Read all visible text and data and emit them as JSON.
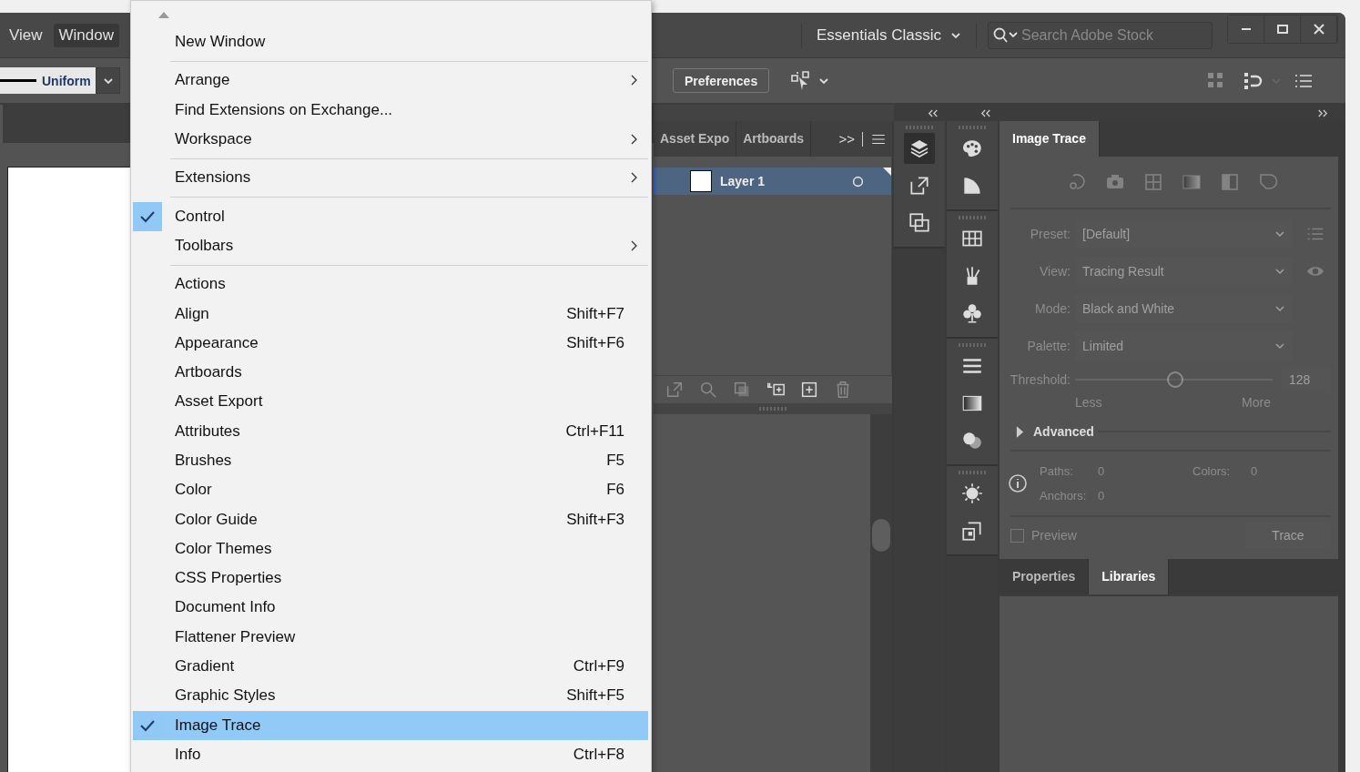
{
  "menubar": [
    {
      "label": "View",
      "selected": false
    },
    {
      "label": "Window",
      "selected": true
    }
  ],
  "workspace": {
    "label": "Essentials Classic"
  },
  "search": {
    "placeholder": "Search Adobe Stock"
  },
  "control_bar": {
    "stroke_profile": "Uniform",
    "preferences_button": "Preferences"
  },
  "layers_panel": {
    "tabs": [
      {
        "label": "Asset Expo",
        "selected": false
      },
      {
        "label": "Artboards",
        "selected": false
      }
    ],
    "overflow": ">>",
    "layers": [
      {
        "name": "Layer 1",
        "selected": true
      }
    ]
  },
  "image_trace": {
    "tabs": [
      {
        "label": "Image Trace",
        "selected": true
      }
    ],
    "disabled": true,
    "fields": [
      {
        "label": "Preset:",
        "value": "[Default]"
      },
      {
        "label": "View:",
        "value": "Tracing Result"
      },
      {
        "label": "Mode:",
        "value": "Black and White"
      },
      {
        "label": "Palette:",
        "value": "Limited"
      }
    ],
    "threshold": {
      "label": "Threshold:",
      "level": 0.5,
      "value": "128",
      "min_label": "Less",
      "max_label": "More"
    },
    "advanced": {
      "label": "Advanced",
      "expanded": false
    },
    "stats": [
      {
        "label": "Paths:",
        "value": "0"
      },
      {
        "label": "Colors:",
        "value": "0"
      },
      {
        "label": "Anchors:",
        "value": "0"
      }
    ],
    "preview": {
      "label": "Preview",
      "checked": false
    },
    "trace_button": "Trace"
  },
  "bottom_tabs": [
    {
      "label": "Properties",
      "selected": false
    },
    {
      "label": "Libraries",
      "selected": true
    }
  ],
  "menu": {
    "items": [
      {
        "kind": "item",
        "label": "New Window",
        "submenu": false,
        "checked": false,
        "selected": false
      },
      {
        "kind": "separator"
      },
      {
        "kind": "item",
        "label": "Arrange",
        "submenu": true,
        "checked": false,
        "selected": false
      },
      {
        "kind": "item",
        "label": "Find Extensions on Exchange...",
        "submenu": false,
        "checked": false,
        "selected": false
      },
      {
        "kind": "item",
        "label": "Workspace",
        "submenu": true,
        "checked": false,
        "selected": false
      },
      {
        "kind": "separator"
      },
      {
        "kind": "item",
        "label": "Extensions",
        "submenu": true,
        "checked": false,
        "selected": false
      },
      {
        "kind": "separator"
      },
      {
        "kind": "item",
        "label": "Control",
        "submenu": false,
        "checked": true,
        "selected": false
      },
      {
        "kind": "item",
        "label": "Toolbars",
        "submenu": true,
        "checked": false,
        "selected": false
      },
      {
        "kind": "separator"
      },
      {
        "kind": "item",
        "label": "Actions",
        "submenu": false,
        "checked": false,
        "selected": false
      },
      {
        "kind": "item",
        "label": "Align",
        "shortcut": "Shift+F7",
        "submenu": false,
        "checked": false,
        "selected": false
      },
      {
        "kind": "item",
        "label": "Appearance",
        "shortcut": "Shift+F6",
        "submenu": false,
        "checked": false,
        "selected": false
      },
      {
        "kind": "item",
        "label": "Artboards",
        "submenu": false,
        "checked": false,
        "selected": false
      },
      {
        "kind": "item",
        "label": "Asset Export",
        "submenu": false,
        "checked": false,
        "selected": false
      },
      {
        "kind": "item",
        "label": "Attributes",
        "shortcut": "Ctrl+F11",
        "submenu": false,
        "checked": false,
        "selected": false
      },
      {
        "kind": "item",
        "label": "Brushes",
        "shortcut": "F5",
        "submenu": false,
        "checked": false,
        "selected": false
      },
      {
        "kind": "item",
        "label": "Color",
        "shortcut": "F6",
        "submenu": false,
        "checked": false,
        "selected": false
      },
      {
        "kind": "item",
        "label": "Color Guide",
        "shortcut": "Shift+F3",
        "submenu": false,
        "checked": false,
        "selected": false
      },
      {
        "kind": "item",
        "label": "Color Themes",
        "submenu": false,
        "checked": false,
        "selected": false
      },
      {
        "kind": "item",
        "label": "CSS Properties",
        "submenu": false,
        "checked": false,
        "selected": false
      },
      {
        "kind": "item",
        "label": "Document Info",
        "submenu": false,
        "checked": false,
        "selected": false
      },
      {
        "kind": "item",
        "label": "Flattener Preview",
        "submenu": false,
        "checked": false,
        "selected": false
      },
      {
        "kind": "item",
        "label": "Gradient",
        "shortcut": "Ctrl+F9",
        "submenu": false,
        "checked": false,
        "selected": false
      },
      {
        "kind": "item",
        "label": "Graphic Styles",
        "shortcut": "Shift+F5",
        "submenu": false,
        "checked": false,
        "selected": false
      },
      {
        "kind": "item",
        "label": "Image Trace",
        "submenu": false,
        "checked": true,
        "selected": true
      },
      {
        "kind": "item",
        "label": "Info",
        "shortcut": "Ctrl+F8",
        "submenu": false,
        "checked": false,
        "selected": false
      }
    ]
  }
}
